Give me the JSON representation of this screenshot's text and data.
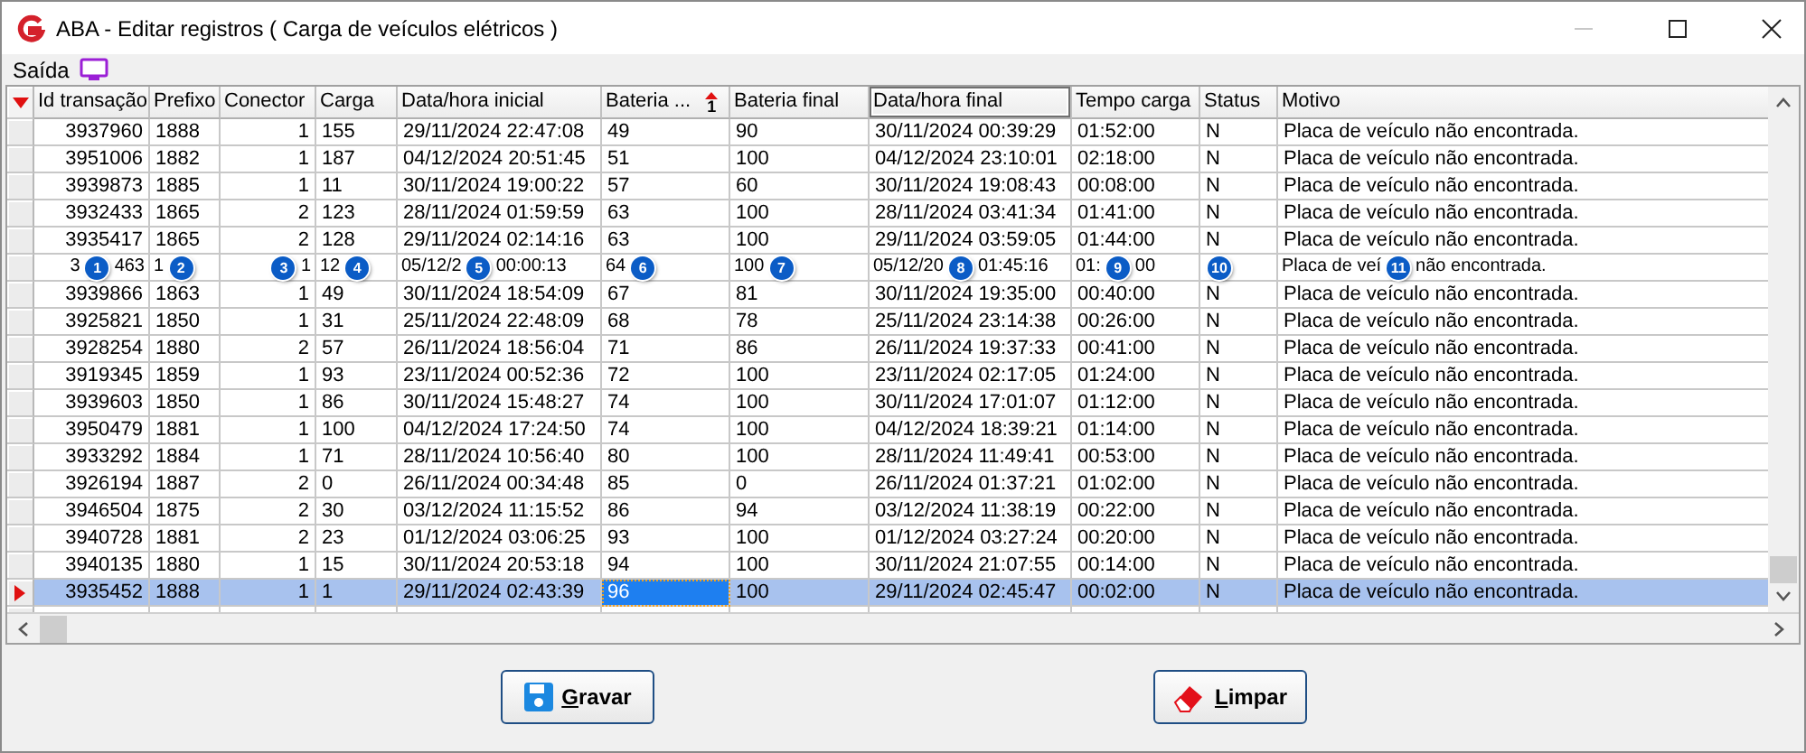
{
  "window": {
    "title": "ABA - Editar registros ( Carga de veículos elétricos )"
  },
  "menu": [
    {
      "label": "Saída"
    }
  ],
  "grid": {
    "columns": [
      {
        "label": "Id transação",
        "kind": "numeric",
        "focused": false
      },
      {
        "label": "Prefixo",
        "kind": "text",
        "focused": false
      },
      {
        "label": "Conector",
        "kind": "numeric",
        "focused": false
      },
      {
        "label": "Carga",
        "kind": "text",
        "focused": false
      },
      {
        "label": "Data/hora inicial",
        "kind": "text",
        "focused": false
      },
      {
        "label": "Bateria ...",
        "kind": "text",
        "focused": false,
        "sort": "1"
      },
      {
        "label": "Bateria final",
        "kind": "text",
        "focused": false
      },
      {
        "label": "Data/hora final",
        "kind": "text",
        "focused": true
      },
      {
        "label": "Tempo carga",
        "kind": "text",
        "focused": false
      },
      {
        "label": "Status",
        "kind": "text",
        "focused": false
      },
      {
        "label": "Motivo",
        "kind": "text",
        "focused": false
      }
    ],
    "rows": [
      {
        "selected": false,
        "cells": [
          "3937960",
          "1888",
          "1",
          "155",
          "29/11/2024 22:47:08",
          "49",
          "90",
          "30/11/2024 00:39:29",
          "01:52:00",
          "N",
          "Placa de veículo não encontrada."
        ]
      },
      {
        "selected": false,
        "cells": [
          "3951006",
          "1882",
          "1",
          "187",
          "04/12/2024 20:51:45",
          "51",
          "100",
          "04/12/2024 23:10:01",
          "02:18:00",
          "N",
          "Placa de veículo não encontrada."
        ]
      },
      {
        "selected": false,
        "cells": [
          "3939873",
          "1885",
          "1",
          "11",
          "30/11/2024 19:00:22",
          "57",
          "60",
          "30/11/2024 19:08:43",
          "00:08:00",
          "N",
          "Placa de veículo não encontrada."
        ]
      },
      {
        "selected": false,
        "cells": [
          "3932433",
          "1865",
          "2",
          "123",
          "28/11/2024 01:59:59",
          "63",
          "100",
          "28/11/2024 03:41:34",
          "01:41:00",
          "N",
          "Placa de veículo não encontrada."
        ]
      },
      {
        "selected": false,
        "cells": [
          "3935417",
          "1865",
          "2",
          "128",
          "29/11/2024 02:14:16",
          "63",
          "100",
          "29/11/2024 03:59:05",
          "01:44:00",
          "N",
          "Placa de veículo não encontrada."
        ]
      },
      {
        "selected": false,
        "cells": [
          {
            "before": "3",
            "marker": "1",
            "after": "463"
          },
          {
            "before": "1",
            "marker": "2"
          },
          {
            "marker": "3",
            "after": "1"
          },
          {
            "before": "12",
            "marker": "4"
          },
          {
            "before": "05/12/2",
            "marker": "5",
            "after": "00:00:13"
          },
          {
            "before": "64",
            "marker": "6"
          },
          {
            "before": "100",
            "marker": "7"
          },
          {
            "before": "05/12/20",
            "marker": "8",
            "after": "01:45:16"
          },
          {
            "before": "01:",
            "marker": "9",
            "after": "00"
          },
          {
            "marker": "10"
          },
          {
            "before": "Placa de veí",
            "marker": "11",
            "after": "não encontrada."
          }
        ]
      },
      {
        "selected": false,
        "cells": [
          "3939866",
          "1863",
          "1",
          "49",
          "30/11/2024 18:54:09",
          "67",
          "81",
          "30/11/2024 19:35:00",
          "00:40:00",
          "N",
          "Placa de veículo não encontrada."
        ]
      },
      {
        "selected": false,
        "cells": [
          "3925821",
          "1850",
          "1",
          "31",
          "25/11/2024 22:48:09",
          "68",
          "78",
          "25/11/2024 23:14:38",
          "00:26:00",
          "N",
          "Placa de veículo não encontrada."
        ]
      },
      {
        "selected": false,
        "cells": [
          "3928254",
          "1880",
          "2",
          "57",
          "26/11/2024 18:56:04",
          "71",
          "86",
          "26/11/2024 19:37:33",
          "00:41:00",
          "N",
          "Placa de veículo não encontrada."
        ]
      },
      {
        "selected": false,
        "cells": [
          "3919345",
          "1859",
          "1",
          "93",
          "23/11/2024 00:52:36",
          "72",
          "100",
          "23/11/2024 02:17:05",
          "01:24:00",
          "N",
          "Placa de veículo não encontrada."
        ]
      },
      {
        "selected": false,
        "cells": [
          "3939603",
          "1850",
          "1",
          "86",
          "30/11/2024 15:48:27",
          "74",
          "100",
          "30/11/2024 17:01:07",
          "01:12:00",
          "N",
          "Placa de veículo não encontrada."
        ]
      },
      {
        "selected": false,
        "cells": [
          "3950479",
          "1881",
          "1",
          "100",
          "04/12/2024 17:24:50",
          "74",
          "100",
          "04/12/2024 18:39:21",
          "01:14:00",
          "N",
          "Placa de veículo não encontrada."
        ]
      },
      {
        "selected": false,
        "cells": [
          "3933292",
          "1884",
          "1",
          "71",
          "28/11/2024 10:56:40",
          "80",
          "100",
          "28/11/2024 11:49:41",
          "00:53:00",
          "N",
          "Placa de veículo não encontrada."
        ]
      },
      {
        "selected": false,
        "cells": [
          "3926194",
          "1887",
          "2",
          "0",
          "26/11/2024 00:34:48",
          "85",
          "0",
          "26/11/2024 01:37:21",
          "01:02:00",
          "N",
          "Placa de veículo não encontrada."
        ]
      },
      {
        "selected": false,
        "cells": [
          "3946504",
          "1875",
          "2",
          "30",
          "03/12/2024 11:15:52",
          "86",
          "94",
          "03/12/2024 11:38:19",
          "00:22:00",
          "N",
          "Placa de veículo não encontrada."
        ]
      },
      {
        "selected": false,
        "cells": [
          "3940728",
          "1881",
          "2",
          "23",
          "01/12/2024 03:06:25",
          "93",
          "100",
          "01/12/2024 03:27:24",
          "00:20:00",
          "N",
          "Placa de veículo não encontrada."
        ]
      },
      {
        "selected": false,
        "cells": [
          "3940135",
          "1880",
          "1",
          "15",
          "30/11/2024 20:53:18",
          "94",
          "100",
          "30/11/2024 21:07:55",
          "00:14:00",
          "N",
          "Placa de veículo não encontrada."
        ]
      },
      {
        "selected": true,
        "cells": [
          "3935452",
          "1888",
          "1",
          "1",
          "29/11/2024 02:43:39",
          {
            "text": "96",
            "focused": true
          },
          "100",
          "29/11/2024 02:45:47",
          "00:02:00",
          "N",
          "Placa de veículo não encontrada."
        ]
      }
    ]
  },
  "buttons": [
    {
      "label": "Gravar",
      "kind": "save"
    },
    {
      "label": "Limpar",
      "kind": "clear"
    }
  ]
}
